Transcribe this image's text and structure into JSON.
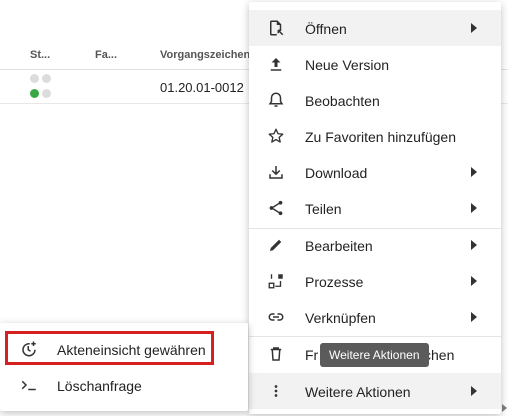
{
  "table": {
    "headers": [
      "St...",
      "Fa...",
      "Vorgangszeichen"
    ],
    "rows": [
      {
        "vorgangszeichen": "01.20.01-0012"
      }
    ]
  },
  "menu": {
    "items": [
      {
        "label": "Öffnen",
        "icon": "file-open-icon",
        "submenu": true
      },
      {
        "label": "Neue Version",
        "icon": "upload-icon",
        "submenu": false
      },
      {
        "label": "Beobachten",
        "icon": "bell-icon",
        "submenu": false
      },
      {
        "label": "Zu Favoriten hinzufügen",
        "icon": "star-icon",
        "submenu": false
      },
      {
        "label": "Download",
        "icon": "download-icon",
        "submenu": true
      },
      {
        "label": "Teilen",
        "icon": "share-icon",
        "submenu": true
      },
      {
        "label": "Bearbeiten",
        "icon": "pencil-icon",
        "submenu": true
      },
      {
        "label": "Prozesse",
        "icon": "process-icon",
        "submenu": true
      },
      {
        "label": "Verknüpfen",
        "icon": "link-icon",
        "submenu": true
      },
      {
        "label": "Freigabe beantragen / Löschen",
        "icon": "trash-icon",
        "submenu": false
      },
      {
        "label": "Weitere Aktionen",
        "icon": "more-vert-icon",
        "submenu": true
      }
    ],
    "trash_label_visible_start": "Fr",
    "trash_label_visible_end": "chen"
  },
  "tooltip": {
    "text": "Weitere Aktionen"
  },
  "submenu": {
    "items": [
      {
        "label": "Akteneinsicht gewähren",
        "icon": "clock-add-icon"
      },
      {
        "label": "Löschanfrage",
        "icon": "terminal-icon"
      }
    ]
  },
  "colors": {
    "focus_border": "#d62020",
    "status_green": "#3aa845",
    "tooltip_bg": "#5b5b5b"
  }
}
